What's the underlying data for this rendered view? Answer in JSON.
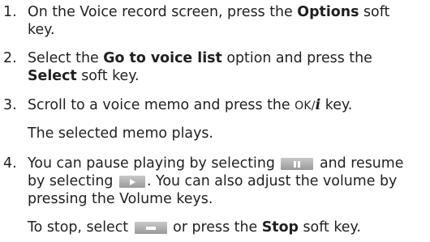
{
  "steps": [
    {
      "number": "1.",
      "line1": {
        "before": "On the Voice record screen, press the ",
        "bold": "Options",
        "after": " soft"
      },
      "line2": "key."
    },
    {
      "number": "2.",
      "line1": {
        "before": "Select the ",
        "bold": "Go to voice list",
        "after": " option and press the"
      },
      "line2": {
        "bold": "Select",
        "after": " soft key."
      }
    },
    {
      "number": "3.",
      "line1": {
        "before": "Scroll to a voice memo and press the ",
        "ok": "OK/",
        "info": "i",
        "after": " key."
      },
      "note": "The selected memo plays."
    },
    {
      "number": "4.",
      "line1": {
        "before": "You can pause playing by selecting ",
        "after": " and resume"
      },
      "line2": {
        "before": "by selecting ",
        "after": ". You can also adjust the volume by"
      },
      "line3": "pressing the Volume keys.",
      "note": {
        "before": "To stop, select ",
        "middle": " or press the ",
        "bold": "Stop",
        "after": " soft key."
      }
    }
  ],
  "icons": {
    "pause": "pause-icon",
    "play": "play-icon",
    "stop": "stop-icon"
  },
  "colors": {
    "text": "#231f20",
    "icon_face": "#9a9a9a"
  }
}
